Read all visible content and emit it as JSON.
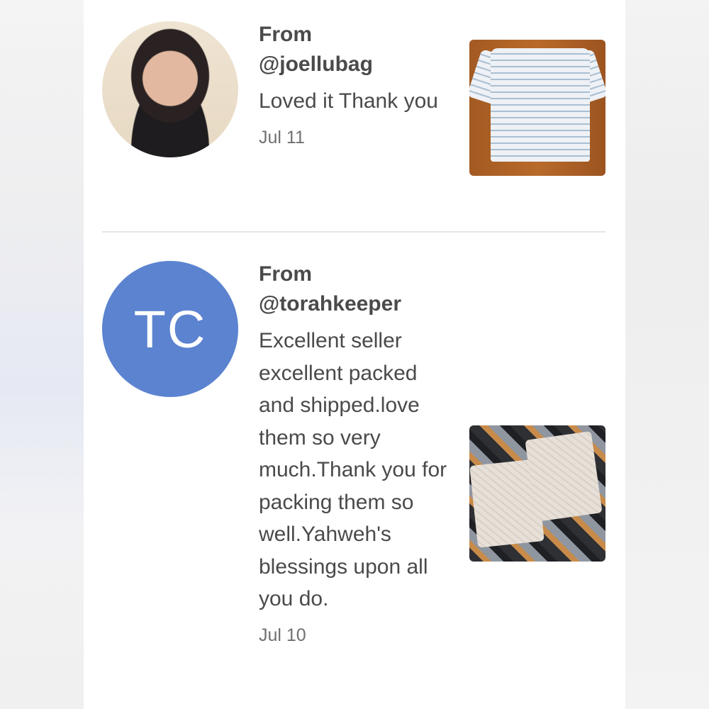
{
  "reviews": [
    {
      "from_label": "From",
      "handle": "@joellubag",
      "message": "Loved it Thank you",
      "date": "Jul 11",
      "avatar": {
        "type": "photo"
      },
      "thumbnail": "striped-top"
    },
    {
      "from_label": "From",
      "handle": "@torahkeeper",
      "message": "Excellent seller excellent packed and shipped.love them so very much.Thank you for packing them so well.Yahweh's blessings upon all you do.",
      "date": "Jul 10",
      "avatar": {
        "type": "initials",
        "initials": "TC",
        "color": "#5b83d0"
      },
      "thumbnail": "pillow-covers"
    }
  ]
}
